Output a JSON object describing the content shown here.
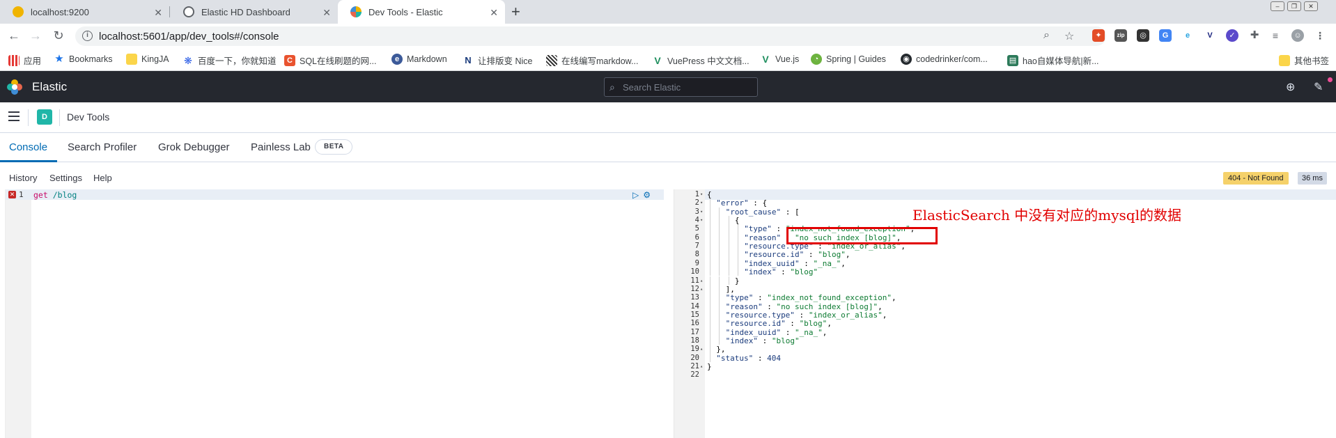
{
  "browser": {
    "tabs": [
      {
        "title": "localhost:9200",
        "active": false
      },
      {
        "title": "Elastic HD Dashboard",
        "active": false
      },
      {
        "title": "Dev Tools - Elastic",
        "active": true
      }
    ],
    "url": "localhost:5601/app/dev_tools#/console",
    "bookmarks": [
      {
        "label": "应用",
        "icon": "apps-grid-icon"
      },
      {
        "label": "Bookmarks",
        "icon": "star-icon"
      },
      {
        "label": "KingJA",
        "icon": "folder-icon"
      },
      {
        "label": "百度一下，你就知道",
        "icon": "baidu-icon"
      },
      {
        "label": "SQL在线刷题的网...",
        "icon": "sql-icon"
      },
      {
        "label": "Markdown",
        "icon": "markdown-icon"
      },
      {
        "label": "让排版变 Nice",
        "icon": "nice-icon"
      },
      {
        "label": "在线编写markdow...",
        "icon": "qr-icon"
      },
      {
        "label": "VuePress 中文文档...",
        "icon": "vue-icon"
      },
      {
        "label": "Vue.js",
        "icon": "vue-icon"
      },
      {
        "label": "Spring | Guides",
        "icon": "spring-icon"
      },
      {
        "label": "codedrinker/com...",
        "icon": "github-icon"
      },
      {
        "label": "hao自媒体导航|新...",
        "icon": "hao-icon"
      }
    ],
    "other_bookmarks": "其他书签"
  },
  "kibana": {
    "brand": "Elastic",
    "search_placeholder": "Search Elastic",
    "space_initial": "D",
    "breadcrumb": "Dev Tools"
  },
  "devtools": {
    "tabs": [
      {
        "label": "Console",
        "active": true
      },
      {
        "label": "Search Profiler",
        "active": false
      },
      {
        "label": "Grok Debugger",
        "active": false
      },
      {
        "label": "Painless Lab",
        "active": false
      }
    ],
    "beta_label": "BETA",
    "sub_links": [
      "History",
      "Settings",
      "Help"
    ],
    "status_badge": "404 - Not Found",
    "timing_badge": "36 ms"
  },
  "request": {
    "line_number": "1",
    "method": "get",
    "path": "/blog"
  },
  "response_lines": [
    {
      "ln": "1",
      "fold": "▾",
      "indent": 0,
      "parts": [
        [
          "p",
          "{"
        ]
      ]
    },
    {
      "ln": "2",
      "fold": "▾",
      "indent": 1,
      "parts": [
        [
          "k",
          "\"error\""
        ],
        [
          "p",
          " : {"
        ]
      ]
    },
    {
      "ln": "3",
      "fold": "▾",
      "indent": 2,
      "parts": [
        [
          "k",
          "\"root_cause\""
        ],
        [
          "p",
          " : ["
        ]
      ]
    },
    {
      "ln": "4",
      "fold": "▾",
      "indent": 3,
      "parts": [
        [
          "p",
          "{"
        ]
      ]
    },
    {
      "ln": "5",
      "fold": "",
      "indent": 4,
      "parts": [
        [
          "k",
          "\"type\""
        ],
        [
          "p",
          " : "
        ],
        [
          "s",
          "\"index_not_found_exception\""
        ],
        [
          "p",
          ","
        ]
      ]
    },
    {
      "ln": "6",
      "fold": "",
      "indent": 4,
      "parts": [
        [
          "k",
          "\"reason\""
        ],
        [
          "p",
          " : "
        ],
        [
          "s",
          "\"no such index [blog]\""
        ],
        [
          "p",
          ","
        ]
      ]
    },
    {
      "ln": "7",
      "fold": "",
      "indent": 4,
      "parts": [
        [
          "k",
          "\"resource.type\""
        ],
        [
          "p",
          " : "
        ],
        [
          "s",
          "\"index_or_alias\""
        ],
        [
          "p",
          ","
        ]
      ]
    },
    {
      "ln": "8",
      "fold": "",
      "indent": 4,
      "parts": [
        [
          "k",
          "\"resource.id\""
        ],
        [
          "p",
          " : "
        ],
        [
          "s",
          "\"blog\""
        ],
        [
          "p",
          ","
        ]
      ]
    },
    {
      "ln": "9",
      "fold": "",
      "indent": 4,
      "parts": [
        [
          "k",
          "\"index_uuid\""
        ],
        [
          "p",
          " : "
        ],
        [
          "s",
          "\"_na_\""
        ],
        [
          "p",
          ","
        ]
      ]
    },
    {
      "ln": "10",
      "fold": "",
      "indent": 4,
      "parts": [
        [
          "k",
          "\"index\""
        ],
        [
          "p",
          " : "
        ],
        [
          "s",
          "\"blog\""
        ]
      ]
    },
    {
      "ln": "11",
      "fold": "▴",
      "indent": 3,
      "parts": [
        [
          "p",
          "}"
        ]
      ]
    },
    {
      "ln": "12",
      "fold": "▴",
      "indent": 2,
      "parts": [
        [
          "p",
          "],"
        ]
      ]
    },
    {
      "ln": "13",
      "fold": "",
      "indent": 2,
      "parts": [
        [
          "k",
          "\"type\""
        ],
        [
          "p",
          " : "
        ],
        [
          "s",
          "\"index_not_found_exception\""
        ],
        [
          "p",
          ","
        ]
      ]
    },
    {
      "ln": "14",
      "fold": "",
      "indent": 2,
      "parts": [
        [
          "k",
          "\"reason\""
        ],
        [
          "p",
          " : "
        ],
        [
          "s",
          "\"no such index [blog]\""
        ],
        [
          "p",
          ","
        ]
      ]
    },
    {
      "ln": "15",
      "fold": "",
      "indent": 2,
      "parts": [
        [
          "k",
          "\"resource.type\""
        ],
        [
          "p",
          " : "
        ],
        [
          "s",
          "\"index_or_alias\""
        ],
        [
          "p",
          ","
        ]
      ]
    },
    {
      "ln": "16",
      "fold": "",
      "indent": 2,
      "parts": [
        [
          "k",
          "\"resource.id\""
        ],
        [
          "p",
          " : "
        ],
        [
          "s",
          "\"blog\""
        ],
        [
          "p",
          ","
        ]
      ]
    },
    {
      "ln": "17",
      "fold": "",
      "indent": 2,
      "parts": [
        [
          "k",
          "\"index_uuid\""
        ],
        [
          "p",
          " : "
        ],
        [
          "s",
          "\"_na_\""
        ],
        [
          "p",
          ","
        ]
      ]
    },
    {
      "ln": "18",
      "fold": "",
      "indent": 2,
      "parts": [
        [
          "k",
          "\"index\""
        ],
        [
          "p",
          " : "
        ],
        [
          "s",
          "\"blog\""
        ]
      ]
    },
    {
      "ln": "19",
      "fold": "▴",
      "indent": 1,
      "parts": [
        [
          "p",
          "},"
        ]
      ]
    },
    {
      "ln": "20",
      "fold": "",
      "indent": 1,
      "parts": [
        [
          "k",
          "\"status\""
        ],
        [
          "p",
          " : "
        ],
        [
          "n",
          "404"
        ]
      ]
    },
    {
      "ln": "21",
      "fold": "▴",
      "indent": 0,
      "parts": [
        [
          "p",
          "}"
        ]
      ]
    },
    {
      "ln": "22",
      "fold": "",
      "indent": 0,
      "parts": []
    }
  ],
  "annotation": {
    "text": "ElasticSearch 中没有对应的mysql的数据",
    "color": "#e10000"
  },
  "colors": {
    "header_bg": "#25282f",
    "accent": "#006bb4",
    "space_avatar": "#20b6a8",
    "warning_badge": "#f5d16a"
  }
}
